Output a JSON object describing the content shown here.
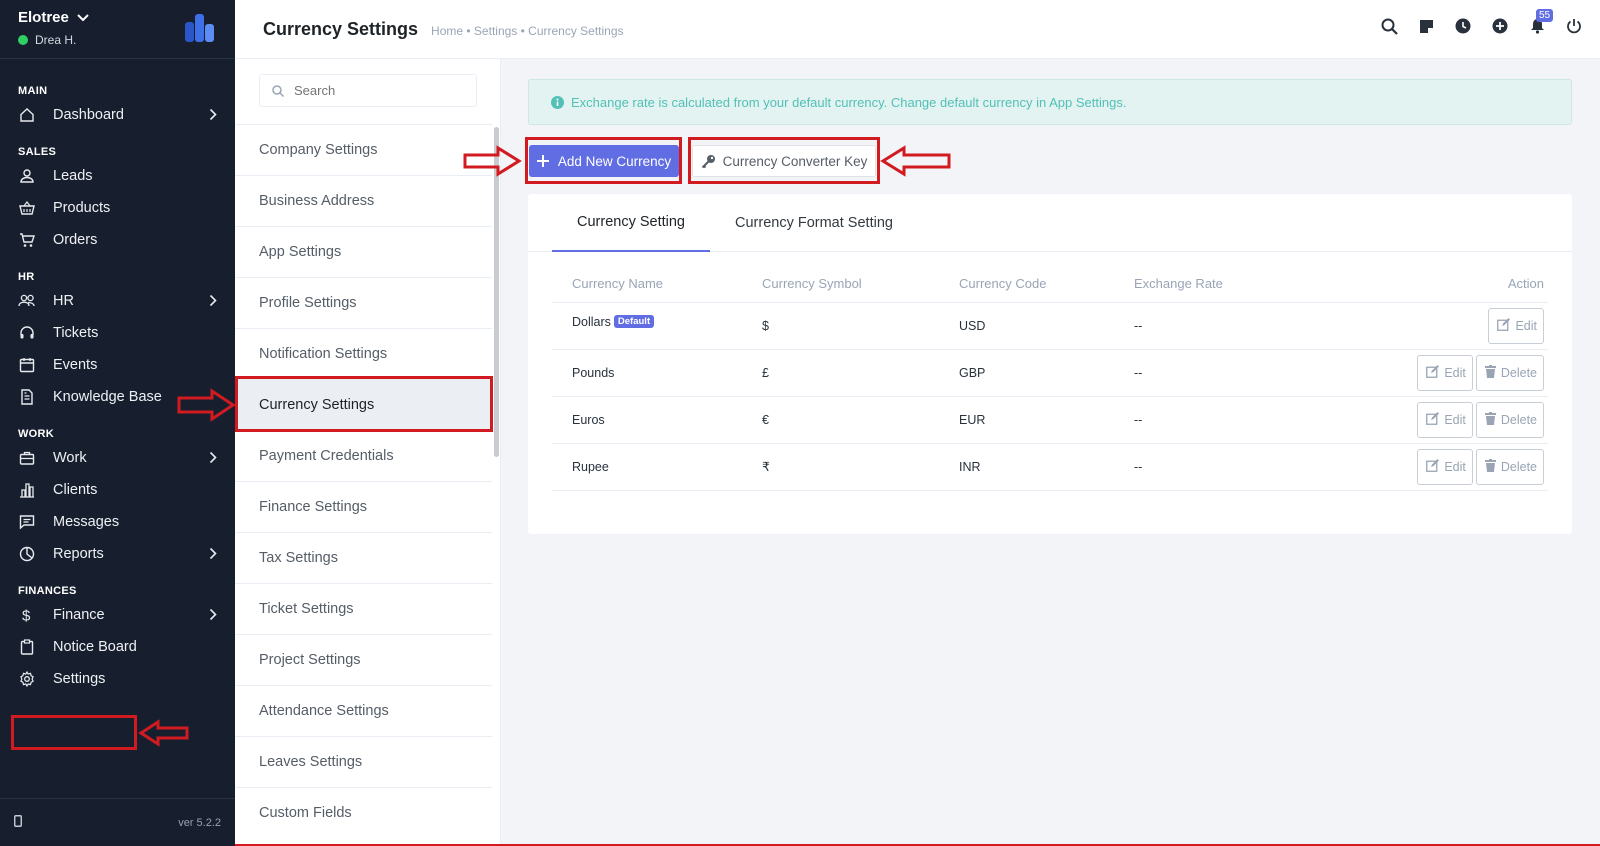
{
  "app": {
    "name": "Elotree",
    "user": "Drea H.",
    "version": "ver 5.2.2"
  },
  "sidebar": {
    "sections": [
      {
        "title": "MAIN",
        "items": [
          {
            "label": "Dashboard",
            "icon": "home-icon",
            "chevron": true
          }
        ]
      },
      {
        "title": "SALES",
        "items": [
          {
            "label": "Leads",
            "icon": "user-icon"
          },
          {
            "label": "Products",
            "icon": "basket-icon"
          },
          {
            "label": "Orders",
            "icon": "cart-icon"
          }
        ]
      },
      {
        "title": "HR",
        "items": [
          {
            "label": "HR",
            "icon": "people-icon",
            "chevron": true
          },
          {
            "label": "Tickets",
            "icon": "headset-icon"
          },
          {
            "label": "Events",
            "icon": "calendar-icon"
          },
          {
            "label": "Knowledge Base",
            "icon": "document-icon"
          }
        ]
      },
      {
        "title": "WORK",
        "items": [
          {
            "label": "Work",
            "icon": "briefcase-icon",
            "chevron": true
          },
          {
            "label": "Clients",
            "icon": "building-icon"
          },
          {
            "label": "Messages",
            "icon": "message-icon"
          },
          {
            "label": "Reports",
            "icon": "pie-chart-icon",
            "chevron": true
          }
        ]
      },
      {
        "title": "FINANCES",
        "items": [
          {
            "label": "Finance",
            "icon": "dollar-icon",
            "chevron": true
          },
          {
            "label": "Notice Board",
            "icon": "clipboard-icon"
          },
          {
            "label": "Settings",
            "icon": "gear-icon"
          }
        ]
      }
    ]
  },
  "header": {
    "title": "Currency Settings",
    "breadcrumb": "Home • Settings • Currency Settings",
    "notification_count": "55"
  },
  "settings_menu": {
    "search_placeholder": "Search",
    "items": [
      "Company Settings",
      "Business Address",
      "App Settings",
      "Profile Settings",
      "Notification Settings",
      "Currency Settings",
      "Payment Credentials",
      "Finance Settings",
      "Tax Settings",
      "Ticket Settings",
      "Project Settings",
      "Attendance Settings",
      "Leaves Settings",
      "Custom Fields"
    ],
    "active": "Currency Settings"
  },
  "alert": {
    "text": "Exchange rate is calculated from your default currency. Change default currency in App Settings."
  },
  "actions": {
    "add_label": "Add New Currency",
    "key_label": "Currency Converter Key"
  },
  "tabs": [
    "Currency Setting",
    "Currency Format Setting"
  ],
  "table": {
    "columns": [
      "Currency Name",
      "Currency Symbol",
      "Currency Code",
      "Exchange Rate",
      "Action"
    ],
    "default_badge": "Default",
    "edit_label": "Edit",
    "delete_label": "Delete",
    "rows": [
      {
        "name": "Dollars",
        "symbol": "$",
        "code": "USD",
        "rate": "--",
        "default": true
      },
      {
        "name": "Pounds",
        "symbol": "£",
        "code": "GBP",
        "rate": "--"
      },
      {
        "name": "Euros",
        "symbol": "€",
        "code": "EUR",
        "rate": "--"
      },
      {
        "name": "Rupee",
        "symbol": "₹",
        "code": "INR",
        "rate": "--"
      }
    ]
  },
  "colors": {
    "accent": "#616ee3",
    "sidebar_bg": "#171f2f",
    "annotation": "#d11b21",
    "alert_text": "#52c0b7"
  }
}
